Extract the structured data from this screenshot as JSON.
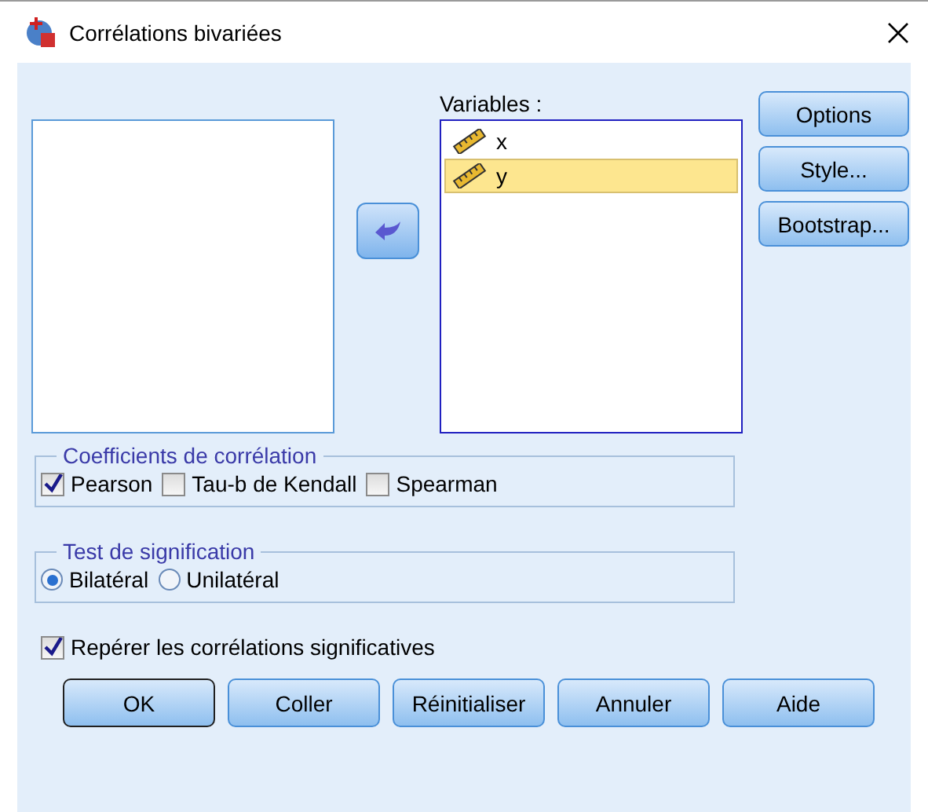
{
  "window": {
    "title": "Corrélations bivariées"
  },
  "variables": {
    "label": "Variables :",
    "items": [
      {
        "name": "x",
        "selected": false
      },
      {
        "name": "y",
        "selected": true
      }
    ]
  },
  "side_buttons": [
    "Options",
    "Style...",
    "Bootstrap..."
  ],
  "coefficients": {
    "title": "Coefficients de corrélation",
    "options": [
      {
        "label": "Pearson",
        "checked": true
      },
      {
        "label": "Tau-b de Kendall",
        "checked": false
      },
      {
        "label": "Spearman",
        "checked": false
      }
    ]
  },
  "test": {
    "title": "Test de signification",
    "options": [
      {
        "label": "Bilatéral",
        "selected": true
      },
      {
        "label": "Unilatéral",
        "selected": false
      }
    ]
  },
  "flag": {
    "label": "Repérer les corrélations significatives",
    "checked": true
  },
  "buttons": [
    {
      "label": "OK",
      "default": true
    },
    {
      "label": "Coller",
      "default": false
    },
    {
      "label": "Réinitialiser",
      "default": false
    },
    {
      "label": "Annuler",
      "default": false
    },
    {
      "label": "Aide",
      "default": false
    }
  ]
}
